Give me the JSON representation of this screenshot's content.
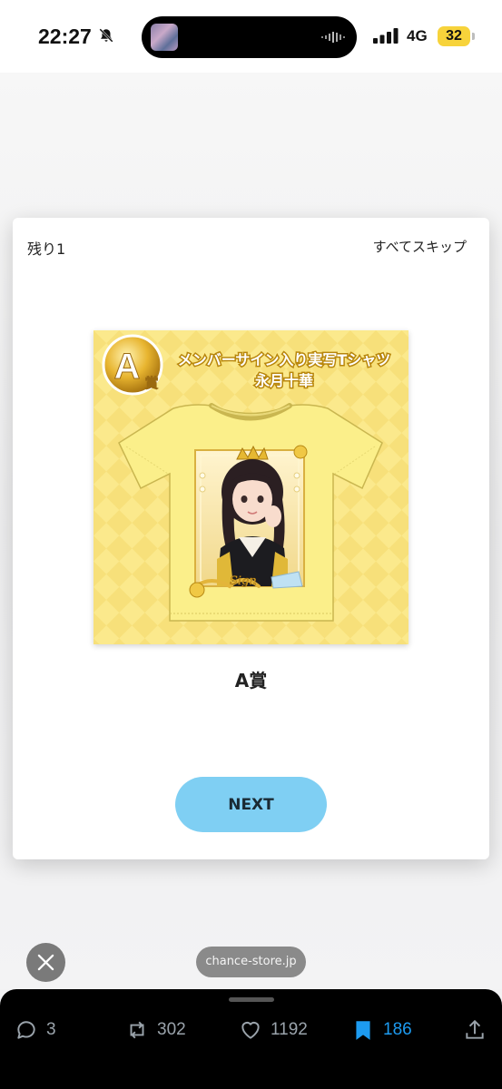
{
  "status_bar": {
    "time": "22:27",
    "network": "4G",
    "battery": "32"
  },
  "modal": {
    "remaining": "残り1",
    "skip_all": "すべてスキップ",
    "prize_image": {
      "grade_badge": "A",
      "grade_suffix": "賞",
      "title_line1": "メンバーサイン入り実写Tシャツ",
      "title_line2": "永月十華"
    },
    "prize_name": "A賞",
    "next_label": "NEXT"
  },
  "overlay": {
    "domain": "chance-store.jp"
  },
  "actions": {
    "replies": "3",
    "reposts": "302",
    "likes": "1192",
    "bookmarks": "186"
  },
  "colors": {
    "next_button": "#7fcff3",
    "bookmark_active": "#1d9bf0",
    "prize_background": "#fbe98c",
    "shirt": "#fbef8a",
    "battery_badge": "#f7d33b"
  },
  "icons": [
    "bell-slash-icon",
    "signal-icon",
    "close-icon",
    "reply-icon",
    "repost-icon",
    "like-icon",
    "bookmark-icon",
    "share-icon"
  ]
}
